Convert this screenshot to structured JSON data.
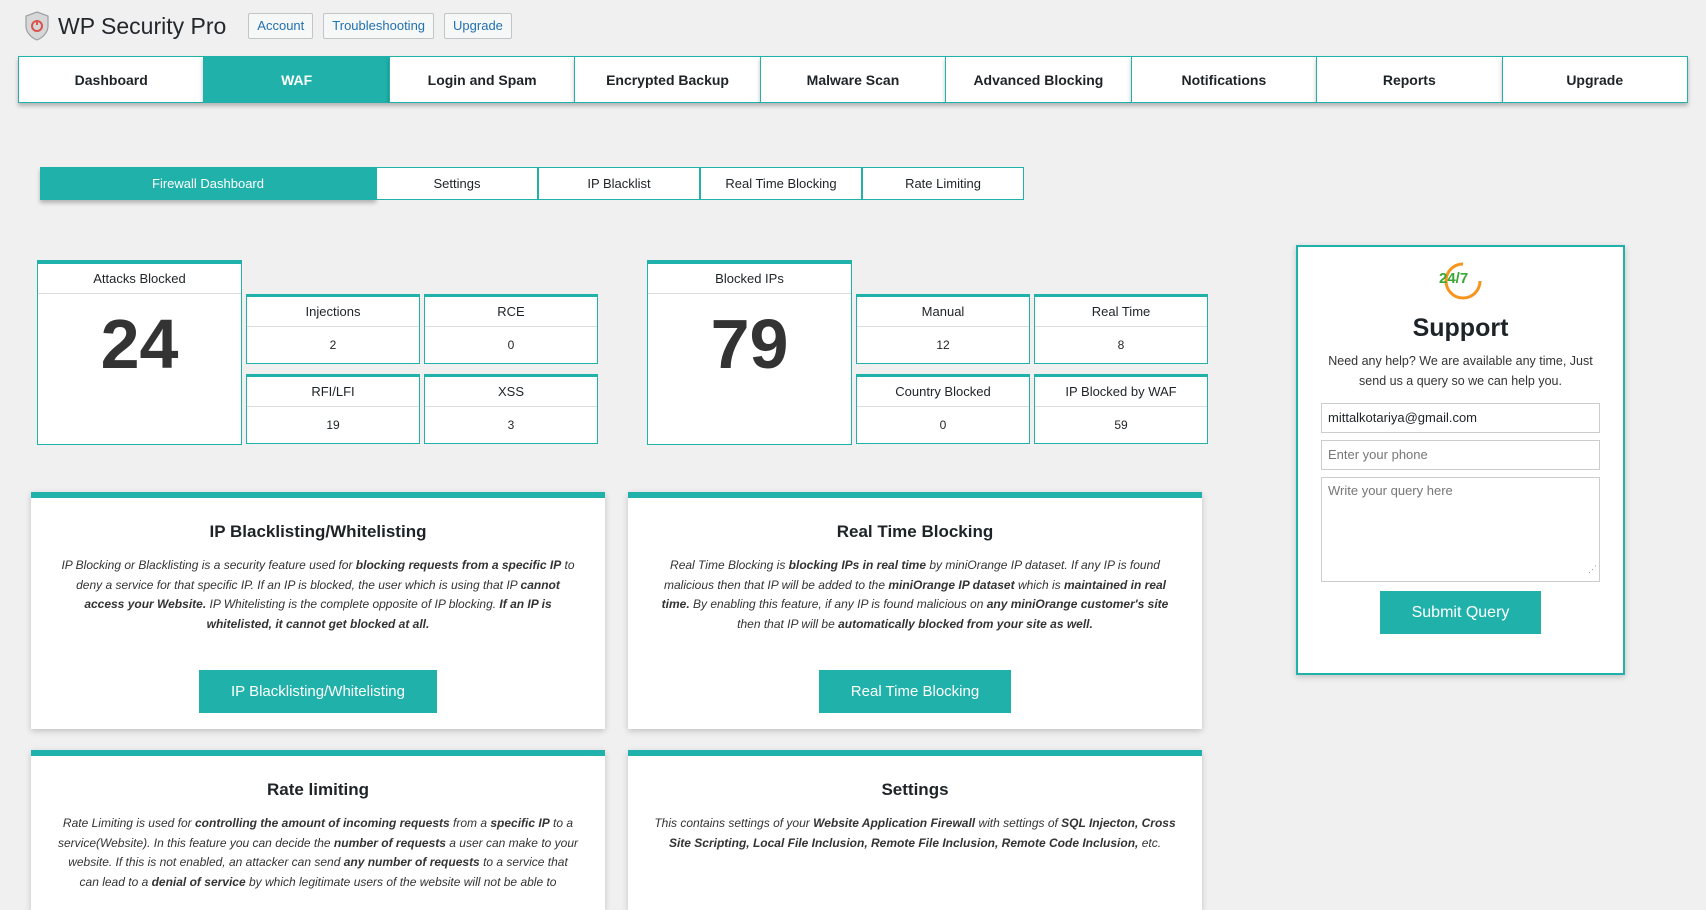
{
  "header": {
    "title": "WP Security Pro",
    "buttons": [
      "Account",
      "Troubleshooting",
      "Upgrade"
    ]
  },
  "main_tabs": [
    {
      "label": "Dashboard"
    },
    {
      "label": "WAF"
    },
    {
      "label": "Login and Spam"
    },
    {
      "label": "Encrypted Backup"
    },
    {
      "label": "Malware Scan"
    },
    {
      "label": "Advanced Blocking"
    },
    {
      "label": "Notifications"
    },
    {
      "label": "Reports"
    },
    {
      "label": "Upgrade"
    }
  ],
  "sub_tabs": [
    {
      "label": "Firewall Dashboard"
    },
    {
      "label": "Settings"
    },
    {
      "label": "IP Blacklist"
    },
    {
      "label": "Real Time Blocking"
    },
    {
      "label": "Rate Limiting"
    }
  ],
  "attacks": {
    "label": "Attacks Blocked",
    "value": "24",
    "items": [
      {
        "label": "Injections",
        "value": "2"
      },
      {
        "label": "RCE",
        "value": "0"
      },
      {
        "label": "RFI/LFI",
        "value": "19"
      },
      {
        "label": "XSS",
        "value": "3"
      }
    ]
  },
  "blocked_ips": {
    "label": "Blocked IPs",
    "value": "79",
    "items": [
      {
        "label": "Manual",
        "value": "12"
      },
      {
        "label": "Real Time",
        "value": "8"
      },
      {
        "label": "Country Blocked",
        "value": "0"
      },
      {
        "label": "IP Blocked by WAF",
        "value": "59"
      }
    ]
  },
  "cards": [
    {
      "title": "IP Blacklisting/Whitelisting",
      "desc": [
        {
          "t": "IP Blocking or Blacklisting is a security feature used for "
        },
        {
          "t": "blocking requests from a specific IP",
          "b": true
        },
        {
          "t": " to deny a service for that specific IP. If an IP is blocked, the user which is using that IP "
        },
        {
          "t": "cannot access your Website.",
          "b": true
        },
        {
          "t": " IP Whitelisting is the complete opposite of IP blocking. "
        },
        {
          "t": "If an IP is whitelisted, it cannot get blocked at all.",
          "b": true
        }
      ],
      "button": "IP Blacklisting/Whitelisting"
    },
    {
      "title": "Real Time Blocking",
      "desc": [
        {
          "t": "Real Time Blocking is "
        },
        {
          "t": "blocking IPs in real time",
          "b": true
        },
        {
          "t": " by miniOrange IP dataset. If any IP is found malicious then that IP will be added to the "
        },
        {
          "t": "miniOrange IP dataset",
          "b": true
        },
        {
          "t": " which is "
        },
        {
          "t": "maintained in real time.",
          "b": true
        },
        {
          "t": " By enabling this feature, if any IP is found malicious on "
        },
        {
          "t": "any miniOrange customer's site",
          "b": true
        },
        {
          "t": " then that IP will be "
        },
        {
          "t": "automatically blocked from your site as well.",
          "b": true
        }
      ],
      "button": "Real Time Blocking"
    },
    {
      "title": "Rate limiting",
      "desc": [
        {
          "t": "Rate Limiting is used for "
        },
        {
          "t": "controlling the amount of incoming requests",
          "b": true
        },
        {
          "t": " from a "
        },
        {
          "t": "specific IP",
          "b": true
        },
        {
          "t": " to a service(Website). In this feature you can decide the "
        },
        {
          "t": "number of requests",
          "b": true
        },
        {
          "t": " a user can make to your website. If this is not enabled, an attacker can send "
        },
        {
          "t": "any number of requests",
          "b": true
        },
        {
          "t": " to a service that can lead to a "
        },
        {
          "t": "denial of service",
          "b": true
        },
        {
          "t": " by which legitimate users of the website will not be able to"
        }
      ]
    },
    {
      "title": "Settings",
      "desc": [
        {
          "t": "This contains settings of your "
        },
        {
          "t": "Website Application Firewall",
          "b": true
        },
        {
          "t": " with settings of "
        },
        {
          "t": "SQL Injecton, Cross Site Scripting, Local File Inclusion, Remote File Inclusion, Remote Code Inclusion,",
          "b": true
        },
        {
          "t": " etc."
        }
      ]
    }
  ],
  "support": {
    "icon_text": "24/7",
    "title": "Support",
    "help": "Need any help? We are available any time, Just send us a query so we can help you.",
    "email_value": "mittalkotariya@gmail.com",
    "phone_placeholder": "Enter your phone",
    "query_placeholder": "Write your query here",
    "submit": "Submit Query"
  },
  "colors": {
    "accent": "#20b2aa",
    "accent_icon_green": "#3aa635",
    "accent_icon_orange": "#f7941d"
  }
}
